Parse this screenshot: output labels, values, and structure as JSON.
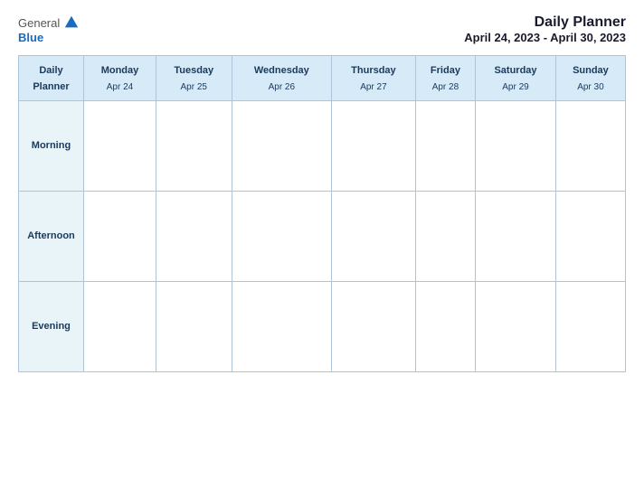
{
  "header": {
    "logo_general": "General",
    "logo_blue": "Blue",
    "main_title": "Daily Planner",
    "date_range": "April 24, 2023 - April 30, 2023"
  },
  "table": {
    "first_col_header": "Daily\nPlanner",
    "days": [
      {
        "name": "Monday",
        "date": "Apr 24"
      },
      {
        "name": "Tuesday",
        "date": "Apr 25"
      },
      {
        "name": "Wednesday",
        "date": "Apr 26"
      },
      {
        "name": "Thursday",
        "date": "Apr 27"
      },
      {
        "name": "Friday",
        "date": "Apr 28"
      },
      {
        "name": "Saturday",
        "date": "Apr 29"
      },
      {
        "name": "Sunday",
        "date": "Apr 30"
      }
    ],
    "rows": [
      {
        "label": "Morning"
      },
      {
        "label": "Afternoon"
      },
      {
        "label": "Evening"
      }
    ]
  }
}
